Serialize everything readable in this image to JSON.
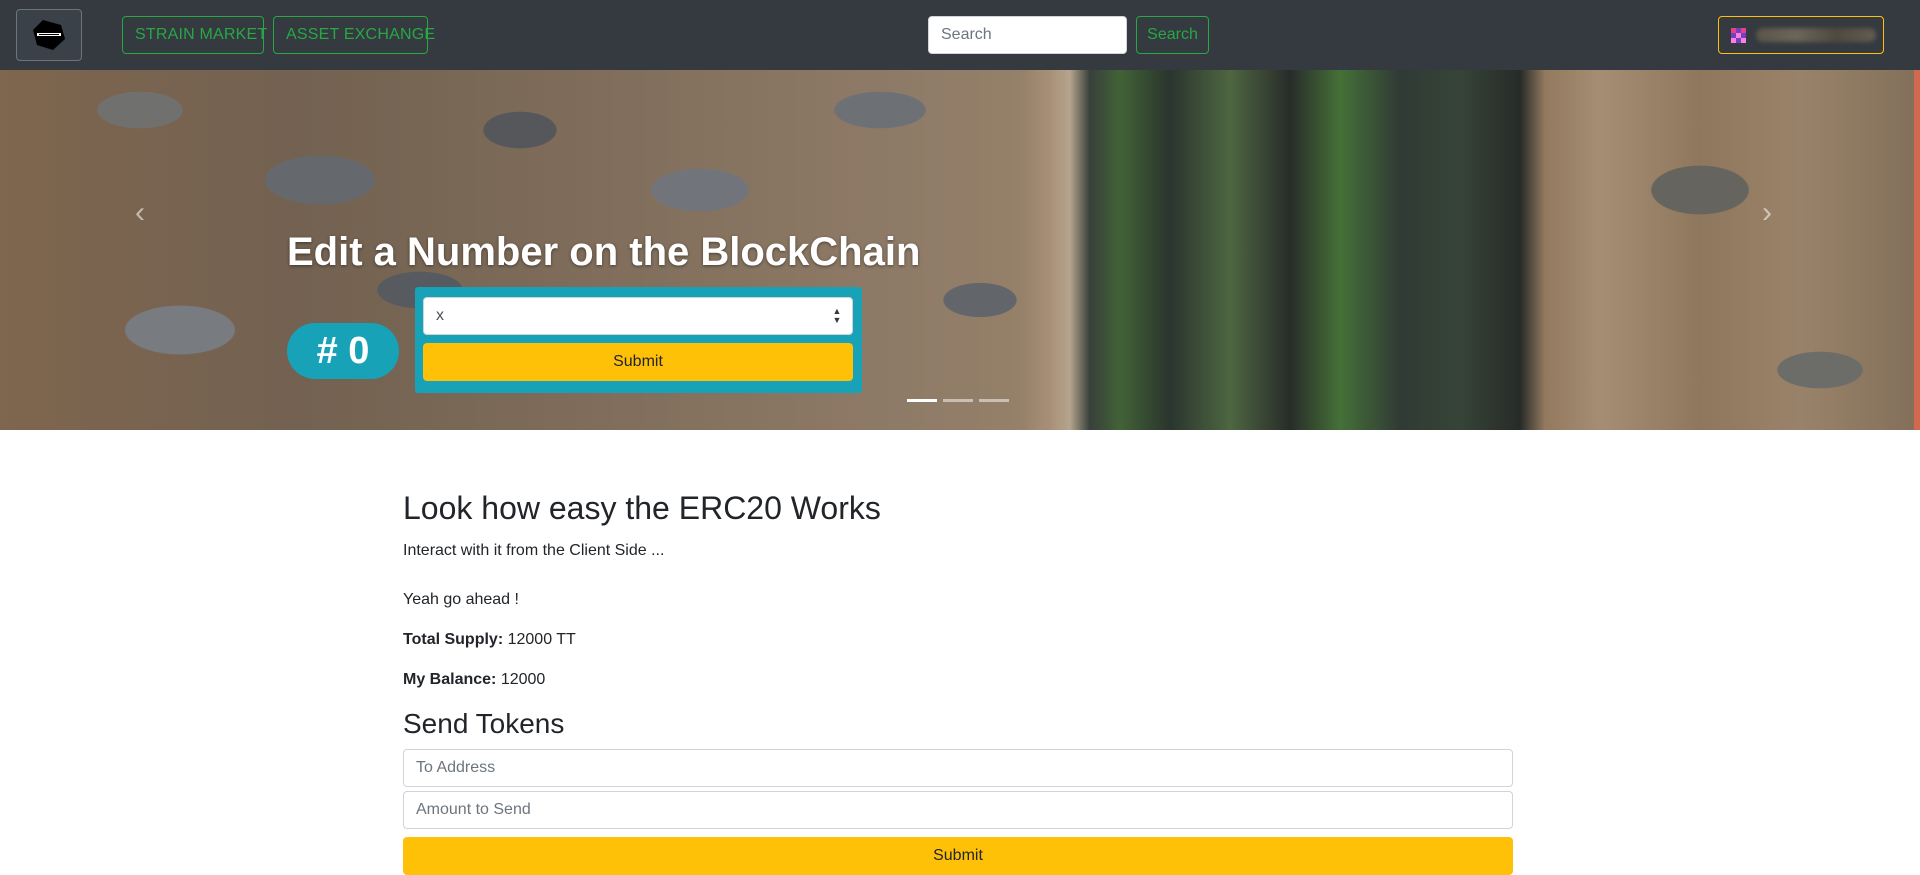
{
  "navbar": {
    "strain_market_label": "STRAIN MARKET",
    "asset_exchange_label": "ASSET EXCHANGE",
    "search_placeholder": "Search",
    "search_button_label": "Search",
    "brand_logo_icon": "uplearth-logo-icon",
    "account_avatar_icon": "identicon-avatar-icon"
  },
  "hero": {
    "title": "Edit a Number on the BlockChain",
    "counter": "# 0",
    "select_value": "x",
    "submit_label": "Submit",
    "prev_icon": "chevron-left-icon",
    "next_icon": "chevron-right-icon",
    "indicators": {
      "count": 3,
      "active": 0
    }
  },
  "erc20": {
    "title": "Look how easy the ERC20 Works",
    "subtitle": "Interact with it from the Client Side ...",
    "prompt": "Yeah go ahead !",
    "total_supply_label": "Total Supply:",
    "total_supply_value": "12000 TT",
    "balance_label": "My Balance:",
    "balance_value": "12000"
  },
  "send_tokens": {
    "title": "Send Tokens",
    "to_placeholder": "To Address",
    "amount_placeholder": "Amount to Send",
    "submit_label": "Submit"
  },
  "colors": {
    "navbar_bg": "#343a40",
    "success": "#28a745",
    "warning": "#ffc107",
    "info": "#17a2b8"
  }
}
